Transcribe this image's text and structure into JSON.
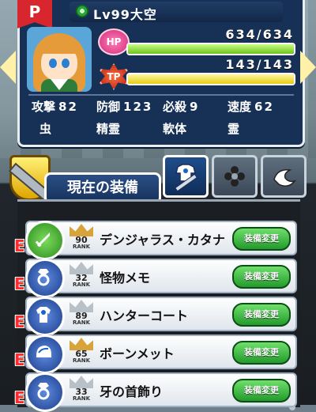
{
  "flag_label": "P",
  "character": {
    "level_text": "Lv99",
    "name": "大空",
    "hp_label": "HP",
    "hp_text": "634/634",
    "hp_fraction": 1.0,
    "tp_label": "TP",
    "tp_text": "143/143",
    "tp_fraction": 1.0
  },
  "stats": [
    {
      "label": "攻撃",
      "value": "82"
    },
    {
      "label": "防御",
      "value": "123"
    },
    {
      "label": "必殺",
      "value": "9"
    },
    {
      "label": "速度",
      "value": "62"
    }
  ],
  "types": [
    "虫",
    "精霊",
    "軟体",
    "霊"
  ],
  "equipment_title": "現在の装備",
  "equipment": [
    {
      "grade": "E",
      "rank": "90",
      "rank_label": "RANK",
      "name": "デンジャラス・カタナ",
      "button": "装備変更",
      "icon": "sword-icon"
    },
    {
      "grade": "E",
      "rank": "32",
      "rank_label": "RANK",
      "name": "怪物メモ",
      "button": "装備変更",
      "icon": "ring-icon"
    },
    {
      "grade": "E",
      "rank": "89",
      "rank_label": "RANK",
      "name": "ハンターコート",
      "button": "装備変更",
      "icon": "shirt-icon"
    },
    {
      "grade": "E",
      "rank": "65",
      "rank_label": "RANK",
      "name": "ボーンメット",
      "button": "装備変更",
      "icon": "helmet-icon"
    },
    {
      "grade": "E",
      "rank": "33",
      "rank_label": "RANK",
      "name": "牙の首飾り",
      "button": "装備変更",
      "icon": "ring-icon"
    }
  ]
}
